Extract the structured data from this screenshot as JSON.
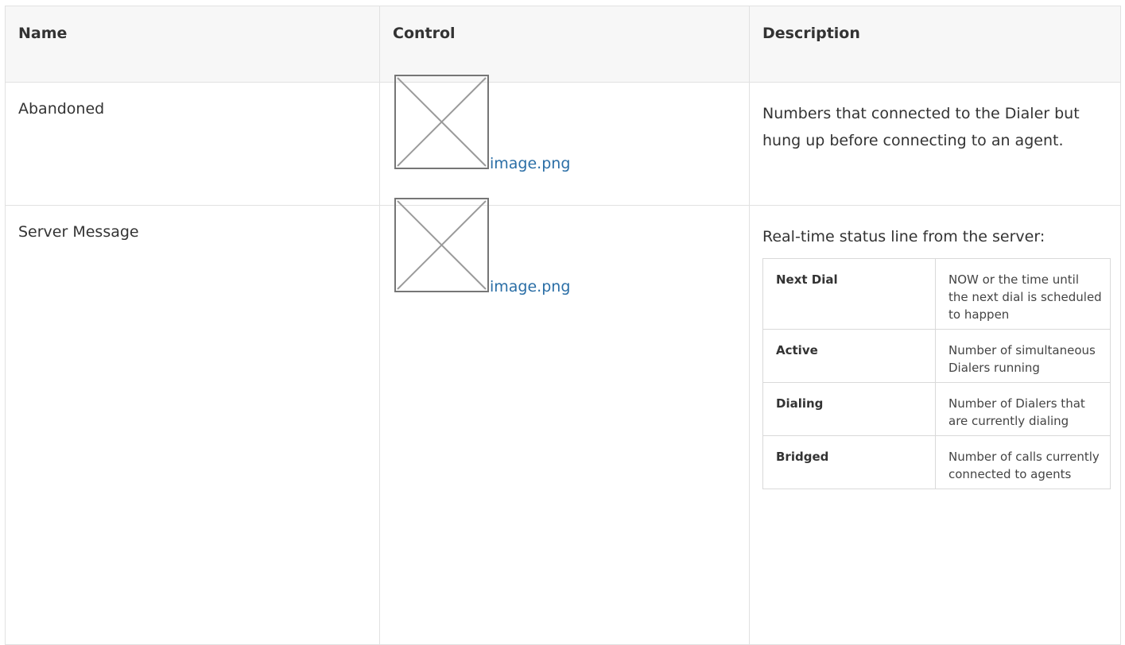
{
  "headers": {
    "name": "Name",
    "control": "Control",
    "description": "Description"
  },
  "rows": [
    {
      "name": "Abandoned",
      "image_link": "image.png",
      "description": "Numbers that connected to the Dialer but hung up before connecting to an agent."
    },
    {
      "name": "Server Message",
      "image_link": "image.png",
      "description": "Real-time status line from the server:",
      "details": [
        {
          "term": "Next Dial",
          "definition": "NOW or the time until the next dial is scheduled to happen"
        },
        {
          "term": "Active",
          "definition": "Number of simultaneous Dialers running"
        },
        {
          "term": "Dialing",
          "definition": "Number of Dialers that are currently dialing"
        },
        {
          "term": "Bridged",
          "definition": "Number of calls currently connected to agents"
        }
      ]
    }
  ],
  "colors": {
    "link": "#2a6ea6",
    "header_bg": "#f7f7f7",
    "border": "#e1e1e1",
    "text": "#333333"
  },
  "icons": {
    "broken_image": "broken-image-icon"
  }
}
